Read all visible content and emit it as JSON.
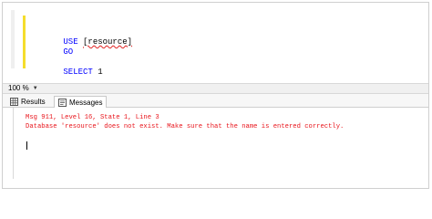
{
  "editor": {
    "lines": [
      {
        "keyword": "USE",
        "ident": "[resource]"
      },
      {
        "keyword": "GO"
      },
      {
        "keyword": "SELECT",
        "value": "1"
      }
    ]
  },
  "zoom": {
    "value": "100 %"
  },
  "tabs": {
    "results": {
      "label": "Results",
      "icon": "grid-icon"
    },
    "messages": {
      "label": "Messages",
      "icon": "message-icon",
      "active": true
    }
  },
  "messages": {
    "lines": [
      "Msg 911, Level 16, State 1, Line 3",
      "Database 'resource' does not exist. Make sure that the name is entered correctly."
    ]
  },
  "colors": {
    "keyword": "#0000ff",
    "error_text": "#e8141b",
    "change_marker": "#f5dd2c"
  }
}
